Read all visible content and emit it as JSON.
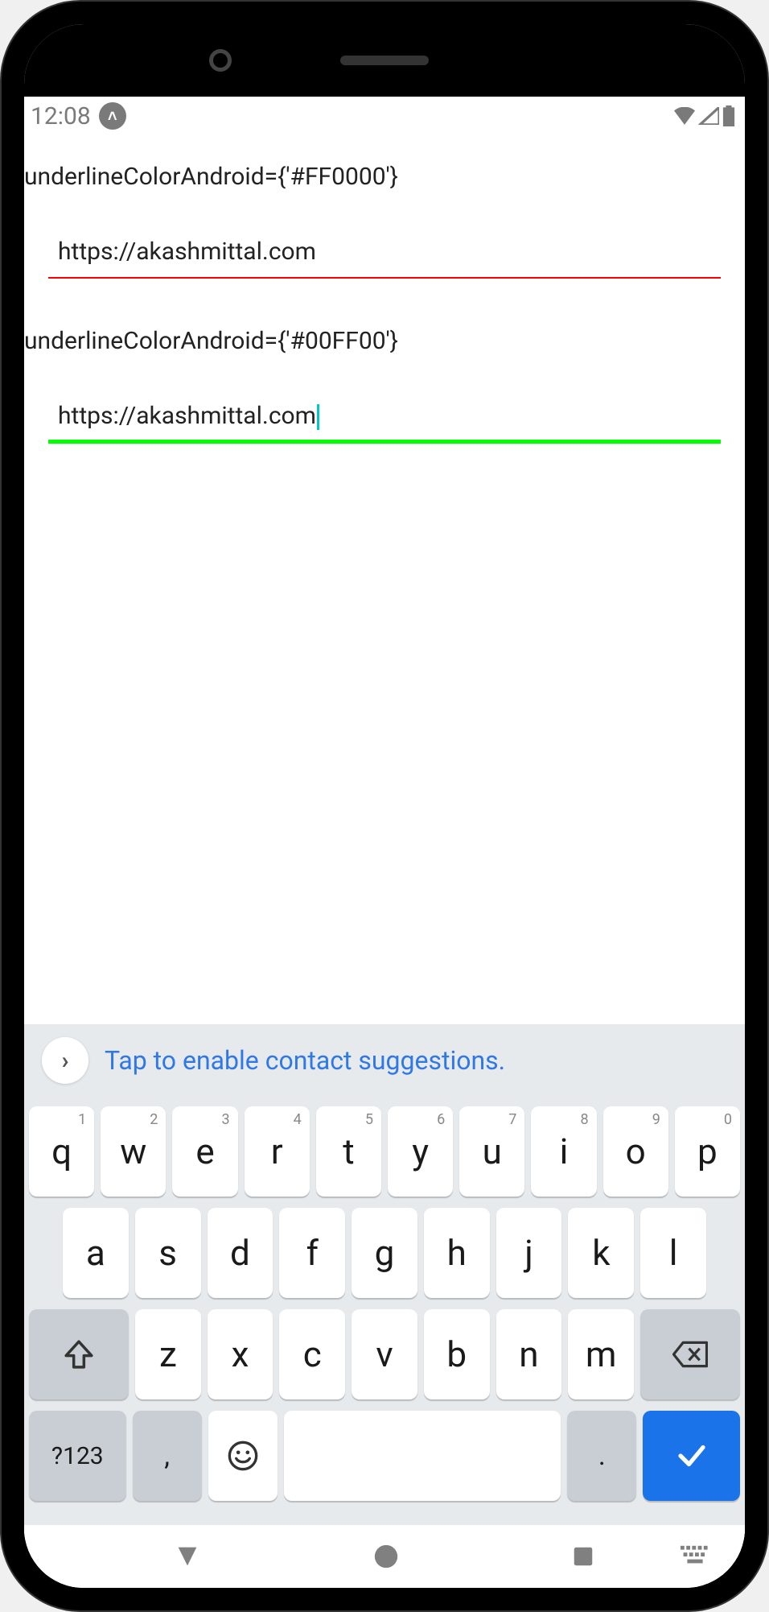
{
  "status": {
    "time": "12:08",
    "app_icon": "˄"
  },
  "screen": {
    "label1": "underlineColorAndroid={'#FF0000'}",
    "input1": "https://akashmittal.com",
    "label2": "underlineColorAndroid={'#00FF00'}",
    "input2": "https://akashmittal.com"
  },
  "suggestion": {
    "text": "Tap to enable contact suggestions.",
    "expand": "›"
  },
  "keys": {
    "row1": [
      {
        "k": "q",
        "n": "1"
      },
      {
        "k": "w",
        "n": "2"
      },
      {
        "k": "e",
        "n": "3"
      },
      {
        "k": "r",
        "n": "4"
      },
      {
        "k": "t",
        "n": "5"
      },
      {
        "k": "y",
        "n": "6"
      },
      {
        "k": "u",
        "n": "7"
      },
      {
        "k": "i",
        "n": "8"
      },
      {
        "k": "o",
        "n": "9"
      },
      {
        "k": "p",
        "n": "0"
      }
    ],
    "row2": [
      "a",
      "s",
      "d",
      "f",
      "g",
      "h",
      "j",
      "k",
      "l"
    ],
    "row3": [
      "z",
      "x",
      "c",
      "v",
      "b",
      "n",
      "m"
    ],
    "shift": "⇧",
    "backspace": "⌫",
    "symbols": "?123",
    "comma": ",",
    "emoji": "☺",
    "period": ".",
    "enter": "✓"
  }
}
